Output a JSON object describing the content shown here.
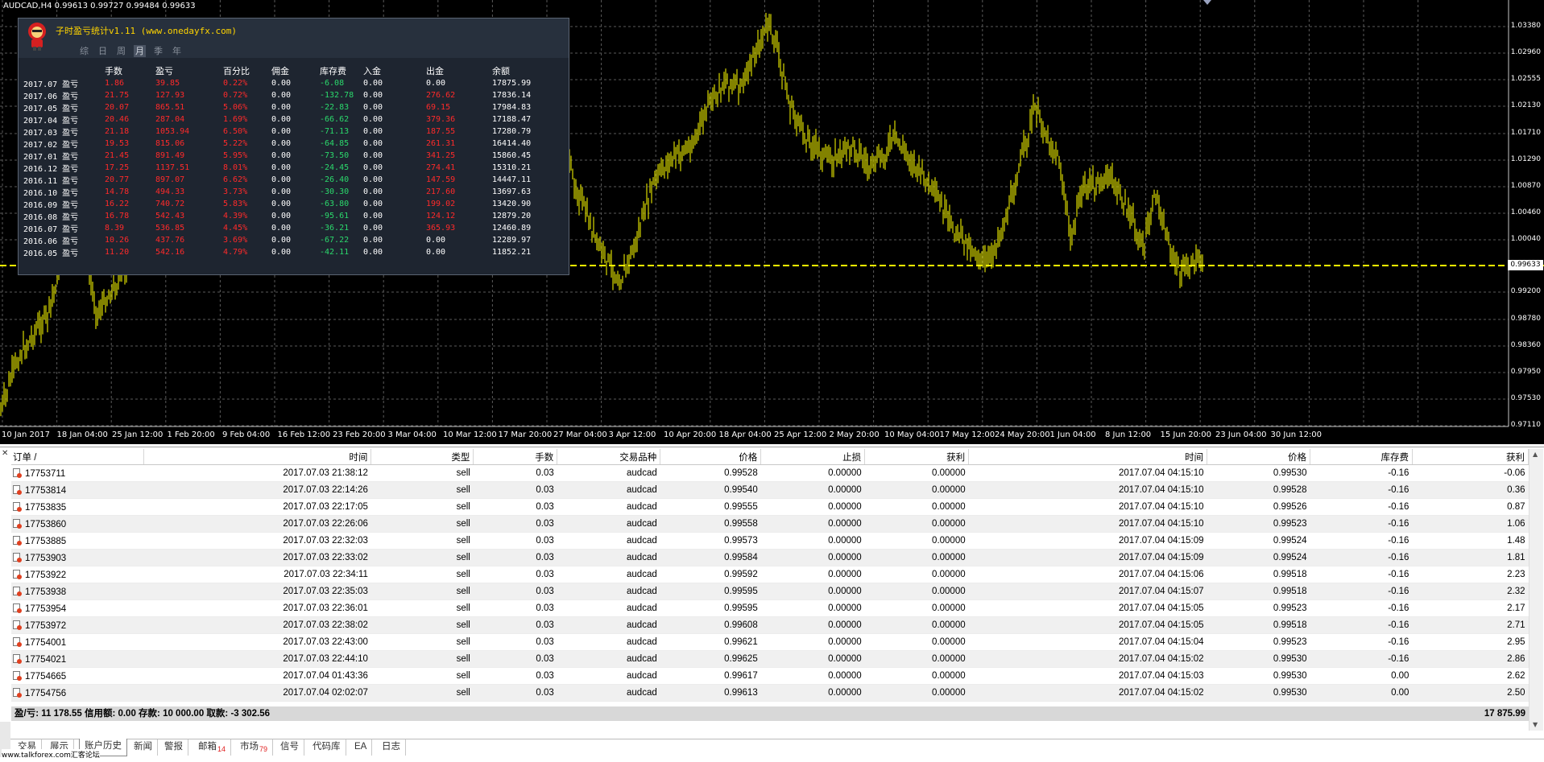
{
  "chart": {
    "title": "AUDCAD,H4  0.99613 0.99727 0.99484 0.99633",
    "current_price": "0.99633",
    "price_labels": [
      "1.03380",
      "1.02960",
      "1.02555",
      "1.02130",
      "1.01710",
      "1.01290",
      "1.00870",
      "1.00460",
      "1.00040",
      "0.99200",
      "0.98780",
      "0.98360",
      "0.97950",
      "0.97530",
      "0.97110"
    ],
    "date_labels": [
      "10 Jan 2017",
      "18 Jan 04:00",
      "25 Jan 12:00",
      "1 Feb 20:00",
      "9 Feb 04:00",
      "16 Feb 12:00",
      "23 Feb 20:00",
      "3 Mar 04:00",
      "10 Mar 12:00",
      "17 Mar 20:00",
      "27 Mar 04:00",
      "3 Apr 12:00",
      "10 Apr 20:00",
      "18 Apr 04:00",
      "25 Apr 12:00",
      "2 May 20:00",
      "10 May 04:00",
      "17 May 12:00",
      "24 May 20:00",
      "1 Jun 04:00",
      "8 Jun 12:00",
      "15 Jun 20:00",
      "23 Jun 04:00",
      "30 Jun 12:00"
    ],
    "bar_color": "#c8c800",
    "price_line_color": "#ffff00"
  },
  "panel": {
    "title": "子时盈亏统计v1.11 (www.onedayfx.com)",
    "tabs": [
      "综",
      "日",
      "周",
      "月",
      "季",
      "年"
    ],
    "active_tab": "月",
    "headers": [
      "",
      "手数",
      "盈亏",
      "百分比",
      "佣金",
      "库存费",
      "入金",
      "出金",
      "余额"
    ],
    "rows": [
      [
        "2017.07 盈亏",
        "1.86",
        "39.85",
        "0.22%",
        "0.00",
        "-6.08",
        "0.00",
        "0.00",
        "17875.99"
      ],
      [
        "2017.06 盈亏",
        "21.75",
        "127.93",
        "0.72%",
        "0.00",
        "-132.78",
        "0.00",
        "276.62",
        "17836.14"
      ],
      [
        "2017.05 盈亏",
        "20.07",
        "865.51",
        "5.06%",
        "0.00",
        "-22.83",
        "0.00",
        "69.15",
        "17984.83"
      ],
      [
        "2017.04 盈亏",
        "20.46",
        "287.04",
        "1.69%",
        "0.00",
        "-66.62",
        "0.00",
        "379.36",
        "17188.47"
      ],
      [
        "2017.03 盈亏",
        "21.18",
        "1053.94",
        "6.50%",
        "0.00",
        "-71.13",
        "0.00",
        "187.55",
        "17280.79"
      ],
      [
        "2017.02 盈亏",
        "19.53",
        "815.06",
        "5.22%",
        "0.00",
        "-64.85",
        "0.00",
        "261.31",
        "16414.40"
      ],
      [
        "2017.01 盈亏",
        "21.45",
        "891.49",
        "5.95%",
        "0.00",
        "-73.50",
        "0.00",
        "341.25",
        "15860.45"
      ],
      [
        "2016.12 盈亏",
        "17.25",
        "1137.51",
        "8.01%",
        "0.00",
        "-24.45",
        "0.00",
        "274.41",
        "15310.21"
      ],
      [
        "2016.11 盈亏",
        "20.77",
        "897.07",
        "6.62%",
        "0.00",
        "-26.40",
        "0.00",
        "147.59",
        "14447.11"
      ],
      [
        "2016.10 盈亏",
        "14.78",
        "494.33",
        "3.73%",
        "0.00",
        "-30.30",
        "0.00",
        "217.60",
        "13697.63"
      ],
      [
        "2016.09 盈亏",
        "16.22",
        "740.72",
        "5.83%",
        "0.00",
        "-63.80",
        "0.00",
        "199.02",
        "13420.90"
      ],
      [
        "2016.08 盈亏",
        "16.78",
        "542.43",
        "4.39%",
        "0.00",
        "-95.61",
        "0.00",
        "124.12",
        "12879.20"
      ],
      [
        "2016.07 盈亏",
        "8.39",
        "536.85",
        "4.45%",
        "0.00",
        "-36.21",
        "0.00",
        "365.93",
        "12460.89"
      ],
      [
        "2016.06 盈亏",
        "10.26",
        "437.76",
        "3.69%",
        "0.00",
        "-67.22",
        "0.00",
        "0.00",
        "12289.97"
      ],
      [
        "2016.05 盈亏",
        "11.20",
        "542.16",
        "4.79%",
        "0.00",
        "-42.11",
        "0.00",
        "0.00",
        "11852.21"
      ]
    ]
  },
  "history": {
    "columns": [
      "订单  /",
      "时间",
      "类型",
      "手数",
      "交易品种",
      "价格",
      "止损",
      "获利",
      "时间",
      "价格",
      "库存费",
      "获利"
    ],
    "rows": [
      [
        "17753711",
        "2017.07.03 21:38:12",
        "sell",
        "0.03",
        "audcad",
        "0.99528",
        "0.00000",
        "0.00000",
        "2017.07.04 04:15:10",
        "0.99530",
        "-0.16",
        "-0.06"
      ],
      [
        "17753814",
        "2017.07.03 22:14:26",
        "sell",
        "0.03",
        "audcad",
        "0.99540",
        "0.00000",
        "0.00000",
        "2017.07.04 04:15:10",
        "0.99528",
        "-0.16",
        "0.36"
      ],
      [
        "17753835",
        "2017.07.03 22:17:05",
        "sell",
        "0.03",
        "audcad",
        "0.99555",
        "0.00000",
        "0.00000",
        "2017.07.04 04:15:10",
        "0.99526",
        "-0.16",
        "0.87"
      ],
      [
        "17753860",
        "2017.07.03 22:26:06",
        "sell",
        "0.03",
        "audcad",
        "0.99558",
        "0.00000",
        "0.00000",
        "2017.07.04 04:15:10",
        "0.99523",
        "-0.16",
        "1.06"
      ],
      [
        "17753885",
        "2017.07.03 22:32:03",
        "sell",
        "0.03",
        "audcad",
        "0.99573",
        "0.00000",
        "0.00000",
        "2017.07.04 04:15:09",
        "0.99524",
        "-0.16",
        "1.48"
      ],
      [
        "17753903",
        "2017.07.03 22:33:02",
        "sell",
        "0.03",
        "audcad",
        "0.99584",
        "0.00000",
        "0.00000",
        "2017.07.04 04:15:09",
        "0.99524",
        "-0.16",
        "1.81"
      ],
      [
        "17753922",
        "2017.07.03 22:34:11",
        "sell",
        "0.03",
        "audcad",
        "0.99592",
        "0.00000",
        "0.00000",
        "2017.07.04 04:15:06",
        "0.99518",
        "-0.16",
        "2.23"
      ],
      [
        "17753938",
        "2017.07.03 22:35:03",
        "sell",
        "0.03",
        "audcad",
        "0.99595",
        "0.00000",
        "0.00000",
        "2017.07.04 04:15:07",
        "0.99518",
        "-0.16",
        "2.32"
      ],
      [
        "17753954",
        "2017.07.03 22:36:01",
        "sell",
        "0.03",
        "audcad",
        "0.99595",
        "0.00000",
        "0.00000",
        "2017.07.04 04:15:05",
        "0.99523",
        "-0.16",
        "2.17"
      ],
      [
        "17753972",
        "2017.07.03 22:38:02",
        "sell",
        "0.03",
        "audcad",
        "0.99608",
        "0.00000",
        "0.00000",
        "2017.07.04 04:15:05",
        "0.99518",
        "-0.16",
        "2.71"
      ],
      [
        "17754001",
        "2017.07.03 22:43:00",
        "sell",
        "0.03",
        "audcad",
        "0.99621",
        "0.00000",
        "0.00000",
        "2017.07.04 04:15:04",
        "0.99523",
        "-0.16",
        "2.95"
      ],
      [
        "17754021",
        "2017.07.03 22:44:10",
        "sell",
        "0.03",
        "audcad",
        "0.99625",
        "0.00000",
        "0.00000",
        "2017.07.04 04:15:02",
        "0.99530",
        "-0.16",
        "2.86"
      ],
      [
        "17754665",
        "2017.07.04 01:43:36",
        "sell",
        "0.03",
        "audcad",
        "0.99617",
        "0.00000",
        "0.00000",
        "2017.07.04 04:15:03",
        "0.99530",
        "0.00",
        "2.62"
      ],
      [
        "17754756",
        "2017.07.04 02:02:07",
        "sell",
        "0.03",
        "audcad",
        "0.99613",
        "0.00000",
        "0.00000",
        "2017.07.04 04:15:02",
        "0.99530",
        "0.00",
        "2.50"
      ]
    ],
    "summary_left": "盈/亏: 11 178.55  信用额: 0.00  存款: 10 000.00  取款: -3 302.56",
    "summary_right": "17 875.99"
  },
  "tabs": [
    {
      "label": "交易"
    },
    {
      "label": "展示"
    },
    {
      "label": "账户历史",
      "active": true
    },
    {
      "label": "新闻"
    },
    {
      "label": "警报"
    },
    {
      "label": "邮箱",
      "badge": "14"
    },
    {
      "label": "市场",
      "badge": "79"
    },
    {
      "label": "信号"
    },
    {
      "label": "代码库"
    },
    {
      "label": "EA"
    },
    {
      "label": "日志"
    }
  ],
  "watermark": "www.talkforex.com汇客论坛"
}
